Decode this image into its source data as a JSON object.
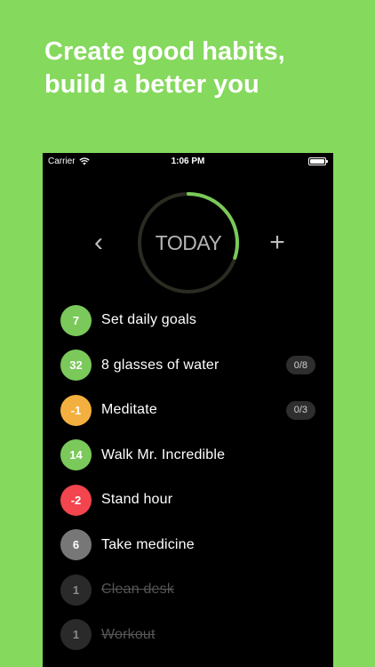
{
  "headline": {
    "line1": "Create good habits,",
    "line2": "build a better you"
  },
  "colors": {
    "background": "#85d95d",
    "accent_green": "#7ac95a",
    "warning_orange": "#f4b03e",
    "danger_red": "#f2454d",
    "neutral_gray": "#777777",
    "done_dark": "#2a2a2a"
  },
  "statusbar": {
    "carrier": "Carrier",
    "time": "1:06 PM",
    "wifi_icon": "wifi-icon",
    "battery_icon": "battery-icon"
  },
  "header": {
    "prev": "‹",
    "title": "TODAY",
    "add": "+",
    "progress_fraction": 0.3
  },
  "habits": [
    {
      "count": "7",
      "name": "Set daily goals",
      "progress": "",
      "color": "#7ac95a",
      "done": false
    },
    {
      "count": "32",
      "name": "8 glasses of water",
      "progress": "0/8",
      "color": "#7ac95a",
      "done": false
    },
    {
      "count": "-1",
      "name": "Meditate",
      "progress": "0/3",
      "color": "#f4b03e",
      "done": false
    },
    {
      "count": "14",
      "name": "Walk Mr. Incredible",
      "progress": "",
      "color": "#7ac95a",
      "done": false
    },
    {
      "count": "-2",
      "name": "Stand hour",
      "progress": "",
      "color": "#f2454d",
      "done": false
    },
    {
      "count": "6",
      "name": "Take medicine",
      "progress": "",
      "color": "#777777",
      "done": false
    },
    {
      "count": "1",
      "name": "Clean desk",
      "progress": "",
      "color": "#2a2a2a",
      "done": true
    },
    {
      "count": "1",
      "name": "Workout",
      "progress": "",
      "color": "#2a2a2a",
      "done": true
    }
  ]
}
